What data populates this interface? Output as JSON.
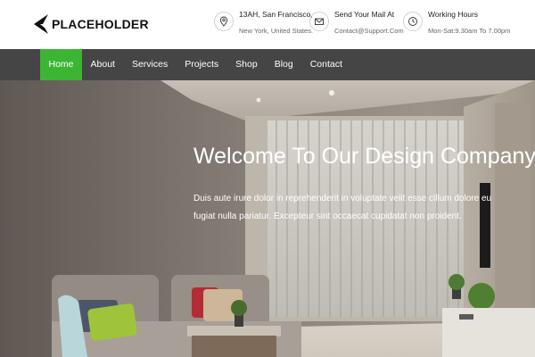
{
  "brand": {
    "logo_text": "PLACEHOLDER"
  },
  "contact": {
    "location": {
      "line1": "13AH, San Francisco,",
      "line2": "New York, United States."
    },
    "mail": {
      "line1": "Send Your Mail At",
      "line2": "Contact@Support.Com"
    },
    "hours": {
      "line1": "Working Hours",
      "line2": "Mon-Sat:9.30am To 7.00pm"
    }
  },
  "nav": {
    "items": [
      {
        "label": "Home",
        "active": true
      },
      {
        "label": "About"
      },
      {
        "label": "Services"
      },
      {
        "label": "Projects"
      },
      {
        "label": "Shop"
      },
      {
        "label": "Blog"
      },
      {
        "label": "Contact"
      }
    ]
  },
  "hero": {
    "title": "Welcome To Our Design Company",
    "text": "Duis aute irure dolor in reprehenderit in voluptate velit esse cillum dolore eu fugiat nulla pariatur. Excepteur sint occaecat cupidatat non proident."
  },
  "colors": {
    "accent": "#3cb534",
    "nav_bg": "#454545"
  },
  "icons": {
    "logo": "logo-mark-icon",
    "location": "map-pin-icon",
    "mail": "envelope-icon",
    "hours": "clock-icon"
  }
}
